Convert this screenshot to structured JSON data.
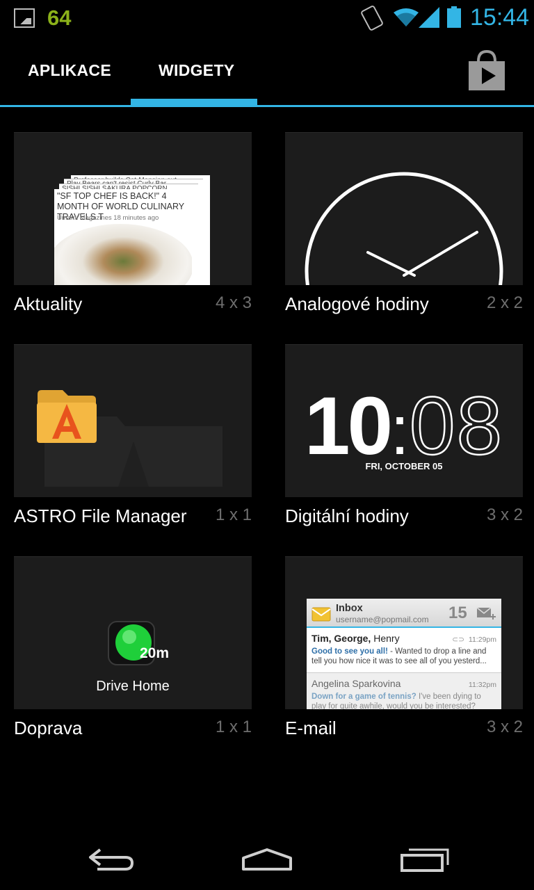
{
  "status_bar": {
    "notification_count": "64",
    "time": "15:44",
    "accent": "#33b5e5"
  },
  "tabs": [
    {
      "label": "APLIKACE",
      "selected": false
    },
    {
      "label": "WIDGETY",
      "selected": true
    }
  ],
  "widgets": [
    {
      "name": "Aktuality",
      "size": "4 x 3",
      "preview": {
        "headlines": [
          "Professor builds Cat-Mansion out",
          "Play Bears can't resist Curly Bar",
          "SISHI SISHI SAKURA POPCORN"
        ],
        "front_headline": "\"SF TOP CHEF IS BACK!\" 4 MONTH OF WORLD CULINARY TRAVELS T",
        "front_meta": "Umami Magazines 18 minutes ago"
      }
    },
    {
      "name": "Analogové hodiny",
      "size": "2 x 2"
    },
    {
      "name": "ASTRO File Manager",
      "size": "1 x 1"
    },
    {
      "name": "Digitální hodiny",
      "size": "3 x 2",
      "preview": {
        "hours": "10",
        "colon": ":",
        "minutes": "08",
        "date": "FRI, OCTOBER 05"
      }
    },
    {
      "name": "Doprava",
      "size": "1 x 1",
      "preview": {
        "eta": "20m",
        "label": "Drive Home"
      }
    },
    {
      "name": "E-mail",
      "size": "3 x 2",
      "preview": {
        "title": "Inbox",
        "account": "username@popmail.com",
        "unread": "15",
        "messages": [
          {
            "from_bold": "Tim, George,",
            "from_rest": " Henry",
            "time": "11:29pm",
            "subject": "Good to see you all!",
            "snippet": " - Wanted to drop a line and tell you how nice it was to see all of you yesterd..."
          },
          {
            "from_bold": "",
            "from_rest": "Angelina Sparkovina",
            "time": "11:32pm",
            "subject": "Down for a game of tennis?",
            "snippet": " I've been dying to play for quite awhile, would you be interested?"
          }
        ]
      }
    }
  ]
}
